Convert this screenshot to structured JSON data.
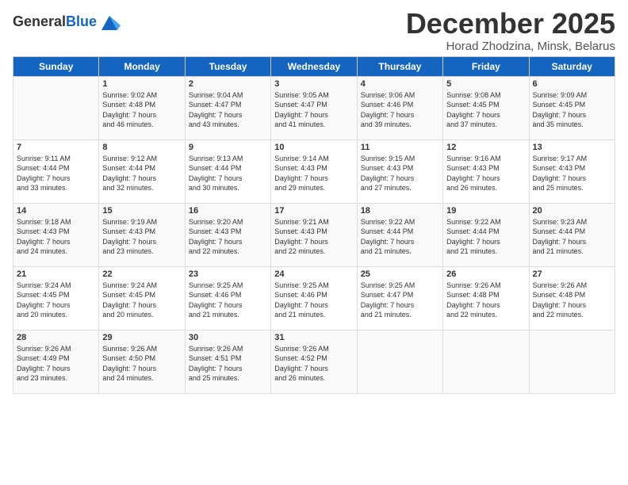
{
  "header": {
    "logo_general": "General",
    "logo_blue": "Blue",
    "month_title": "December 2025",
    "subtitle": "Horad Zhodzina, Minsk, Belarus"
  },
  "weekdays": [
    "Sunday",
    "Monday",
    "Tuesday",
    "Wednesday",
    "Thursday",
    "Friday",
    "Saturday"
  ],
  "weeks": [
    [
      {
        "day": "",
        "info": ""
      },
      {
        "day": "1",
        "info": "Sunrise: 9:02 AM\nSunset: 4:48 PM\nDaylight: 7 hours\nand 46 minutes."
      },
      {
        "day": "2",
        "info": "Sunrise: 9:04 AM\nSunset: 4:47 PM\nDaylight: 7 hours\nand 43 minutes."
      },
      {
        "day": "3",
        "info": "Sunrise: 9:05 AM\nSunset: 4:47 PM\nDaylight: 7 hours\nand 41 minutes."
      },
      {
        "day": "4",
        "info": "Sunrise: 9:06 AM\nSunset: 4:46 PM\nDaylight: 7 hours\nand 39 minutes."
      },
      {
        "day": "5",
        "info": "Sunrise: 9:08 AM\nSunset: 4:45 PM\nDaylight: 7 hours\nand 37 minutes."
      },
      {
        "day": "6",
        "info": "Sunrise: 9:09 AM\nSunset: 4:45 PM\nDaylight: 7 hours\nand 35 minutes."
      }
    ],
    [
      {
        "day": "7",
        "info": "Sunrise: 9:11 AM\nSunset: 4:44 PM\nDaylight: 7 hours\nand 33 minutes."
      },
      {
        "day": "8",
        "info": "Sunrise: 9:12 AM\nSunset: 4:44 PM\nDaylight: 7 hours\nand 32 minutes."
      },
      {
        "day": "9",
        "info": "Sunrise: 9:13 AM\nSunset: 4:44 PM\nDaylight: 7 hours\nand 30 minutes."
      },
      {
        "day": "10",
        "info": "Sunrise: 9:14 AM\nSunset: 4:43 PM\nDaylight: 7 hours\nand 29 minutes."
      },
      {
        "day": "11",
        "info": "Sunrise: 9:15 AM\nSunset: 4:43 PM\nDaylight: 7 hours\nand 27 minutes."
      },
      {
        "day": "12",
        "info": "Sunrise: 9:16 AM\nSunset: 4:43 PM\nDaylight: 7 hours\nand 26 minutes."
      },
      {
        "day": "13",
        "info": "Sunrise: 9:17 AM\nSunset: 4:43 PM\nDaylight: 7 hours\nand 25 minutes."
      }
    ],
    [
      {
        "day": "14",
        "info": "Sunrise: 9:18 AM\nSunset: 4:43 PM\nDaylight: 7 hours\nand 24 minutes."
      },
      {
        "day": "15",
        "info": "Sunrise: 9:19 AM\nSunset: 4:43 PM\nDaylight: 7 hours\nand 23 minutes."
      },
      {
        "day": "16",
        "info": "Sunrise: 9:20 AM\nSunset: 4:43 PM\nDaylight: 7 hours\nand 22 minutes."
      },
      {
        "day": "17",
        "info": "Sunrise: 9:21 AM\nSunset: 4:43 PM\nDaylight: 7 hours\nand 22 minutes."
      },
      {
        "day": "18",
        "info": "Sunrise: 9:22 AM\nSunset: 4:44 PM\nDaylight: 7 hours\nand 21 minutes."
      },
      {
        "day": "19",
        "info": "Sunrise: 9:22 AM\nSunset: 4:44 PM\nDaylight: 7 hours\nand 21 minutes."
      },
      {
        "day": "20",
        "info": "Sunrise: 9:23 AM\nSunset: 4:44 PM\nDaylight: 7 hours\nand 21 minutes."
      }
    ],
    [
      {
        "day": "21",
        "info": "Sunrise: 9:24 AM\nSunset: 4:45 PM\nDaylight: 7 hours\nand 20 minutes."
      },
      {
        "day": "22",
        "info": "Sunrise: 9:24 AM\nSunset: 4:45 PM\nDaylight: 7 hours\nand 20 minutes."
      },
      {
        "day": "23",
        "info": "Sunrise: 9:25 AM\nSunset: 4:46 PM\nDaylight: 7 hours\nand 21 minutes."
      },
      {
        "day": "24",
        "info": "Sunrise: 9:25 AM\nSunset: 4:46 PM\nDaylight: 7 hours\nand 21 minutes."
      },
      {
        "day": "25",
        "info": "Sunrise: 9:25 AM\nSunset: 4:47 PM\nDaylight: 7 hours\nand 21 minutes."
      },
      {
        "day": "26",
        "info": "Sunrise: 9:26 AM\nSunset: 4:48 PM\nDaylight: 7 hours\nand 22 minutes."
      },
      {
        "day": "27",
        "info": "Sunrise: 9:26 AM\nSunset: 4:48 PM\nDaylight: 7 hours\nand 22 minutes."
      }
    ],
    [
      {
        "day": "28",
        "info": "Sunrise: 9:26 AM\nSunset: 4:49 PM\nDaylight: 7 hours\nand 23 minutes."
      },
      {
        "day": "29",
        "info": "Sunrise: 9:26 AM\nSunset: 4:50 PM\nDaylight: 7 hours\nand 24 minutes."
      },
      {
        "day": "30",
        "info": "Sunrise: 9:26 AM\nSunset: 4:51 PM\nDaylight: 7 hours\nand 25 minutes."
      },
      {
        "day": "31",
        "info": "Sunrise: 9:26 AM\nSunset: 4:52 PM\nDaylight: 7 hours\nand 26 minutes."
      },
      {
        "day": "",
        "info": ""
      },
      {
        "day": "",
        "info": ""
      },
      {
        "day": "",
        "info": ""
      }
    ]
  ]
}
